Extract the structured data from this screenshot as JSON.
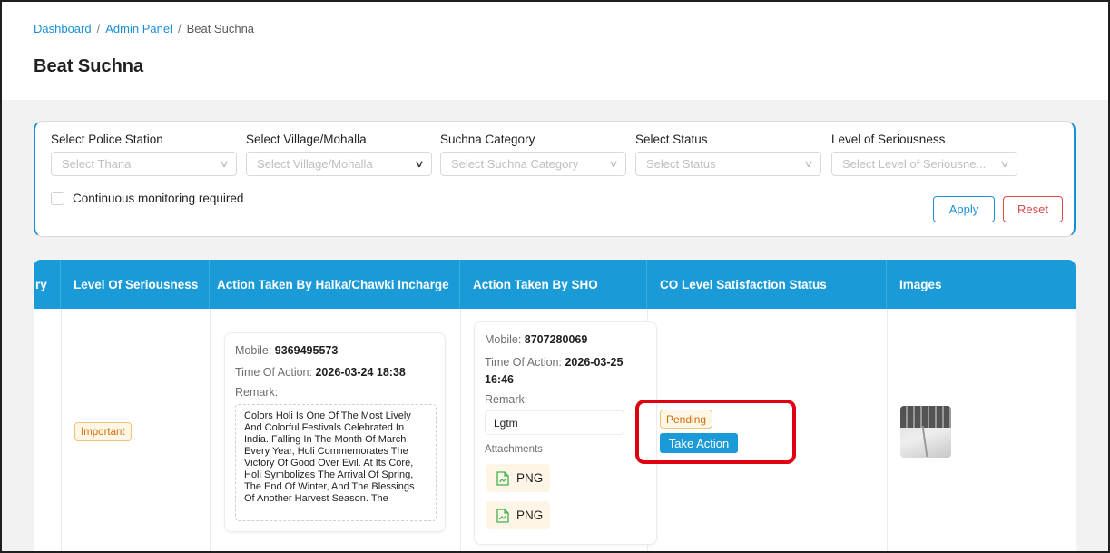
{
  "breadcrumb": {
    "dashboard": "Dashboard",
    "admin_panel": "Admin Panel",
    "current": "Beat Suchna",
    "separator": "/"
  },
  "page_title": "Beat Suchna",
  "filters": {
    "police_station": {
      "label": "Select Police Station",
      "placeholder": "Select Thana"
    },
    "village": {
      "label": "Select Village/Mohalla",
      "placeholder": "Select Village/Mohalla"
    },
    "category": {
      "label": "Suchna Category",
      "placeholder": "Select Suchna Category"
    },
    "status": {
      "label": "Select Status",
      "placeholder": "Select Status"
    },
    "seriousness": {
      "label": "Level of Seriousness",
      "placeholder": "Select Level of Seriousne..."
    },
    "continuous_monitoring": "Continuous monitoring required",
    "apply_label": "Apply",
    "reset_label": "Reset"
  },
  "table": {
    "columns": [
      "ry",
      "Level Of Seriousness",
      "Action Taken By Halka/Chawki Incharge",
      "Action Taken By SHO",
      "CO Level Satisfaction Status",
      "Images"
    ],
    "row": {
      "seriousness": "Important",
      "halka": {
        "mobile_label": "Mobile:",
        "mobile": "9369495573",
        "time_label": "Time Of Action:",
        "time": "2026-03-24 18:38",
        "remark_label": "Remark:",
        "remark": "Colors Holi Is One Of The Most Lively And Colorful Festivals Celebrated In India. Falling In The Month Of March Every Year, Holi Commemorates The Victory Of Good Over Evil. At Its Core, Holi Symbolizes The Arrival Of Spring, The End Of Winter, And The Blessings Of Another Harvest Season. The"
      },
      "sho": {
        "mobile_label": "Mobile:",
        "mobile": "8707280069",
        "time_label": "Time Of Action:",
        "time_part1": "2026-03-25",
        "time_part2": "16:46",
        "remark_label": "Remark:",
        "remark": "Lgtm",
        "attachments_label": "Attachments",
        "attachments": [
          "PNG",
          "PNG"
        ]
      },
      "co_status": "Pending",
      "take_action_label": "Take Action"
    }
  },
  "colors": {
    "primary": "#1a9ad6",
    "link": "#1a8fd3",
    "danger": "#e0474c",
    "warning_text": "#d46b08",
    "highlight": "#e00012"
  }
}
